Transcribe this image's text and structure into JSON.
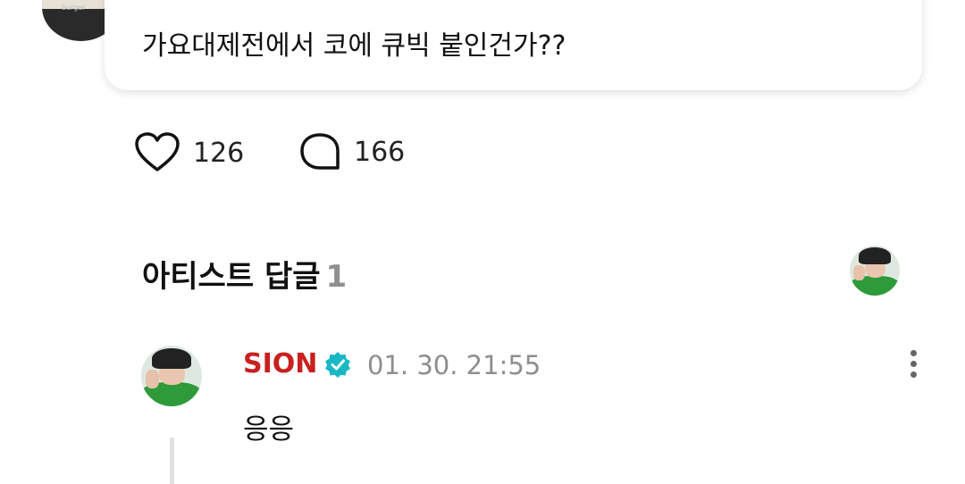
{
  "post": {
    "text": "가요대제전에서 코에 큐빅 붙인건가??",
    "avatar_icon": "user-avatar-food",
    "likes": "126",
    "replies": "166"
  },
  "artist_replies": {
    "title": "아티스트 답글",
    "count": "1",
    "avatar_icon": "artist-avatar"
  },
  "comment": {
    "author": "SION",
    "verified_icon": "verified-badge-icon",
    "timestamp": "01. 30. 21:55",
    "text": "응응",
    "author_color": "#c8201f",
    "badge_color": "#18b7c6"
  }
}
